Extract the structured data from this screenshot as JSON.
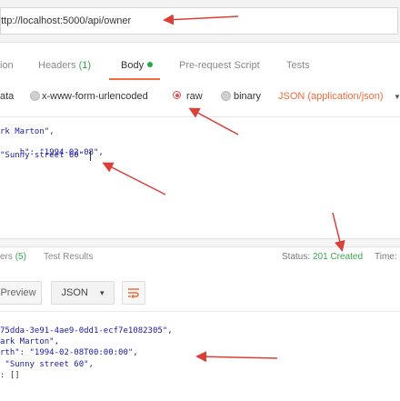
{
  "url_bar": {
    "url": "http://localhost:5000/api/owner"
  },
  "request_tabs": {
    "authorization_fragment": "ion",
    "headers_label": "Headers",
    "headers_count": "(1)",
    "body_label": "Body",
    "prerequest_label": "Pre-request Script",
    "tests_label": "Tests"
  },
  "body_types": {
    "form_data_fragment": "ata",
    "urlencoded": "x-www-form-urlencoded",
    "raw": "raw",
    "binary": "binary",
    "content_type": "JSON (application/json)"
  },
  "request_body": {
    "line1": "rk Marton\",",
    "line2_key": "h\": ",
    "line2_val": "\"1994-02-08\",",
    "line3": "\"Sunny street 60\""
  },
  "response_tabs": {
    "headers_fragment": "ers",
    "headers_count": "(5)",
    "test_results": "Test Results",
    "status_label": "Status:",
    "status_value": "201 Created",
    "time_label": "Time:"
  },
  "response_toolbar": {
    "preview": "Preview",
    "format": "JSON",
    "format_caret": "▾",
    "wrap_icon": "wrap-lines-icon"
  },
  "response_body": {
    "line1": "75dda-3e91-4ae9-0dd1-ecf7e1082305\",",
    "line2": "ark Marton\",",
    "line3": "rth\": \"1994-02-08T00:00:00\",",
    "line4": " \"Sunny street 60\",",
    "line5": ": []"
  },
  "colors": {
    "accent": "#f26b3a",
    "status_green": "#3aa64f",
    "arrow_red": "#d9403a",
    "string_blue": "#1a1aa6"
  }
}
